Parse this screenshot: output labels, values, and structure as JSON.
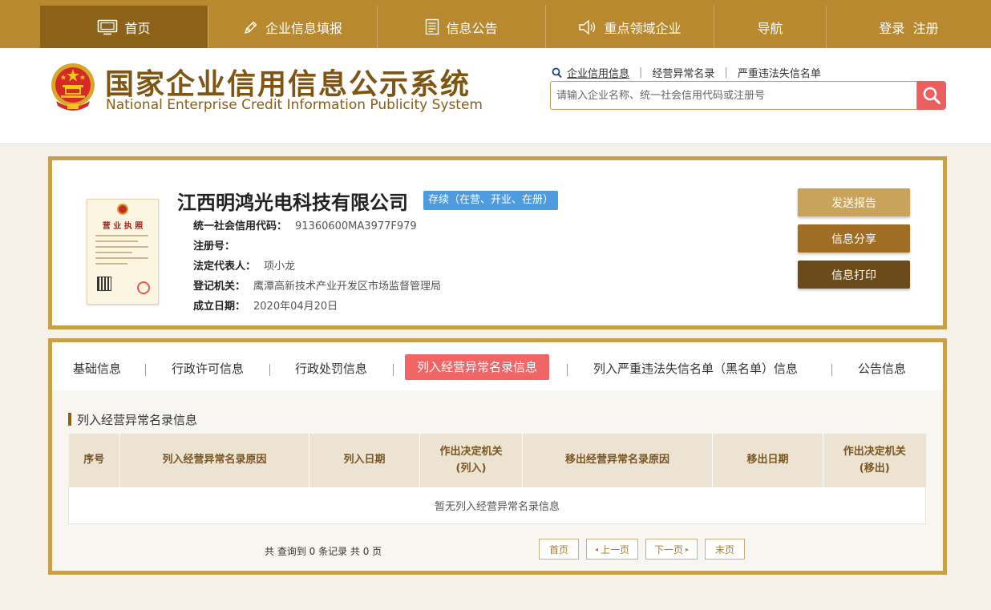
{
  "nav": {
    "items": [
      {
        "label": "首页",
        "icon": "monitor-icon"
      },
      {
        "label": "企业信息填报",
        "icon": "pen-icon"
      },
      {
        "label": "信息公告",
        "icon": "document-icon"
      },
      {
        "label": "重点领域企业",
        "icon": "speaker-icon"
      },
      {
        "label": "导航",
        "icon": ""
      },
      {
        "label": "登录  注册",
        "icon": ""
      }
    ]
  },
  "header": {
    "title_cn": "国家企业信用信息公示系统",
    "title_en": "National Enterprise Credit Information Publicity System",
    "search_tabs": [
      "企业信用信息",
      "经营异常名录",
      "严重违法失信名单"
    ],
    "search_placeholder": "请输入企业名称、统一社会信用代码或注册号"
  },
  "company": {
    "name": "江西明鸿光电科技有限公司",
    "status": "存续（在营、开业、在册）",
    "license_caption": "营 业 执 照",
    "fields": [
      {
        "label": "统一社会信用代码：",
        "value": "91360600MA3977F979"
      },
      {
        "label": "注册号：",
        "value": ""
      },
      {
        "label": "法定代表人：",
        "value": "项小龙"
      },
      {
        "label": "登记机关：",
        "value": "鹰潭高新技术产业开发区市场监督管理局"
      },
      {
        "label": "成立日期：",
        "value": "2020年04月20日"
      }
    ],
    "actions": [
      {
        "label": "发送报告",
        "color": "#c9a35a"
      },
      {
        "label": "信息分享",
        "color": "#a06d25"
      },
      {
        "label": "信息打印",
        "color": "#6b4b1a"
      }
    ]
  },
  "tabs": [
    {
      "label": "基础信息"
    },
    {
      "label": "行政许可信息"
    },
    {
      "label": "行政处罚信息"
    },
    {
      "label": "列入经营异常名录信息"
    },
    {
      "label": "列入严重违法失信名单（黑名单）信息"
    },
    {
      "label": "公告信息"
    }
  ],
  "active_tab": "列入经营异常名录信息",
  "section": {
    "title": "列入经营异常名录信息",
    "columns": [
      "序号",
      "列入经营异常名录原因",
      "列入日期",
      "作出决定机关\n(列入)",
      "移出经营异常名录原因",
      "移出日期",
      "作出决定机关\n(移出)"
    ],
    "empty_message": "暂无列入经营异常名录信息"
  },
  "pagination": {
    "summary": "共 查询到 0 条记录 共 0 页",
    "first": "首页",
    "prev": "上一页",
    "next": "下一页",
    "last": "末页"
  },
  "colors": {
    "nav_bg": "#b8892e",
    "nav_active": "#8c6218",
    "border_gold": "#c9a04a",
    "active_tab": "#f06565",
    "status_badge": "#4e9be0",
    "search_button": "#ed5e5e"
  }
}
